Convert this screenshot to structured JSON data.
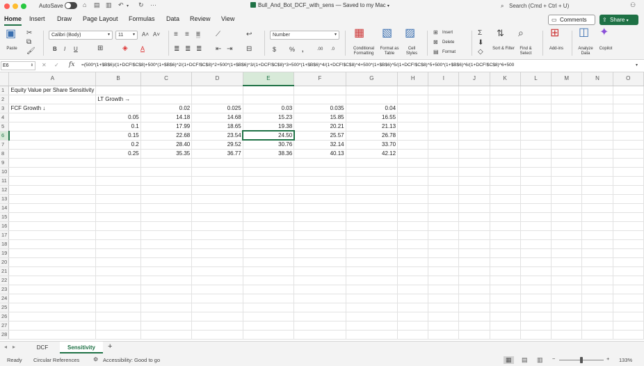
{
  "titlebar": {
    "autosave_label": "AutoSave",
    "document_title": "Bull_And_Bot_DCF_with_sens — Saved to my Mac",
    "search_placeholder": "Search (Cmd + Ctrl + U)"
  },
  "ribbon_tabs": [
    "Home",
    "Insert",
    "Draw",
    "Page Layout",
    "Formulas",
    "Data",
    "Review",
    "View"
  ],
  "ribbon_actions": {
    "comments": "Comments",
    "share": "Share"
  },
  "ribbon": {
    "paste": "Paste",
    "font_name": "Calibri (Body)",
    "font_size": "11",
    "number_format": "Number",
    "conditional_formatting": "Conditional Formatting",
    "format_as_table": "Format as Table",
    "cell_styles": "Cell Styles",
    "insert": "Insert",
    "delete": "Delete",
    "format": "Format",
    "sort_filter": "Sort & Filter",
    "find_select": "Find & Select",
    "add_ins": "Add-ins",
    "analyze_data": "Analyze Data",
    "copilot": "Copilot"
  },
  "formula_bar": {
    "name_box": "E6",
    "formula": "=(500*(1+$B$6)/(1+DCF!$C$8)+500*(1+$B$6)^2/(1+DCF!$C$8)^2+500*(1+$B$6)^3/(1+DCF!$C$8)^3+500*(1+$B$6)^4/(1+DCF!$C$8)^4+500*(1+$B$6)^5/(1+DCF!$C$8)^5+500*(1+$B$6)^6/(1+DCF!$C$8)^6+500"
  },
  "columns": [
    "A",
    "B",
    "C",
    "D",
    "E",
    "F",
    "G",
    "H",
    "I",
    "J",
    "K",
    "L",
    "M",
    "N",
    "O"
  ],
  "active_cell": "E6",
  "cells": {
    "A1": "Equity Value per Share Sensitivity",
    "B2": "LT Growth →",
    "A3": "FCF Growth ↓",
    "C3": "0.02",
    "D3": "0.025",
    "E3": "0.03",
    "F3": "0.035",
    "G3": "0.04",
    "B4": "0.05",
    "C4": "14.18",
    "D4": "14.68",
    "E4": "15.23",
    "F4": "15.85",
    "G4": "16.55",
    "B5": "0.1",
    "C5": "17.99",
    "D5": "18.65",
    "E5": "19.38",
    "F5": "20.21",
    "G5": "21.13",
    "B6": "0.15",
    "C6": "22.68",
    "D6": "23.54",
    "E6": "24.50",
    "F6": "25.57",
    "G6": "26.78",
    "B7": "0.2",
    "C7": "28.40",
    "D7": "29.52",
    "E7": "30.76",
    "F7": "32.14",
    "G7": "33.70",
    "B8": "0.25",
    "C8": "35.35",
    "D8": "36.77",
    "E8": "38.36",
    "F8": "40.13",
    "G8": "42.12"
  },
  "sheets": [
    "DCF",
    "Sensitivity"
  ],
  "active_sheet": "Sensitivity",
  "statusbar": {
    "ready": "Ready",
    "circular_references": "Circular References",
    "accessibility": "Accessibility: Good to go",
    "zoom": "133%"
  }
}
